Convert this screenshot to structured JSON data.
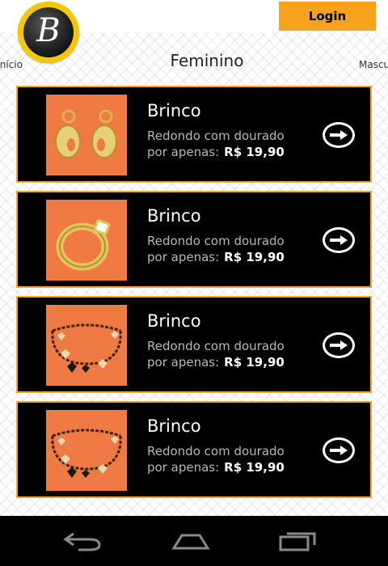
{
  "header": {
    "logo_letter": "B",
    "login_label": "Login"
  },
  "category_nav": {
    "left": "Início",
    "center": "Feminino",
    "right": "Masculino"
  },
  "products": [
    {
      "title": "Brinco",
      "description": "Redondo com dourado",
      "price_label": "por apenas:",
      "price": "R$ 19,90",
      "image": "earrings"
    },
    {
      "title": "Brinco",
      "description": "Redondo com dourado",
      "price_label": "por apenas:",
      "price": "R$ 19,90",
      "image": "ring"
    },
    {
      "title": "Brinco",
      "description": "Redondo com dourado",
      "price_label": "por apenas:",
      "price": "R$ 19,90",
      "image": "bracelet"
    },
    {
      "title": "Brinco",
      "description": "Redondo com dourado",
      "price_label": "por apenas:",
      "price": "R$ 19,90",
      "image": "bracelet"
    }
  ],
  "system_nav": {
    "buttons": [
      "back-icon",
      "home-icon",
      "recent-apps-icon"
    ]
  },
  "colors": {
    "accent": "#f7a21b",
    "card_bg": "#000000",
    "thumb_bg": "#f07a44"
  }
}
